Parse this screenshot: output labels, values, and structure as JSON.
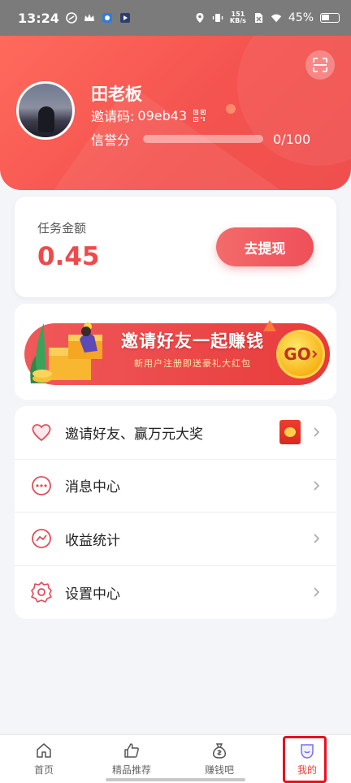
{
  "status_bar": {
    "time": "13:24",
    "network_speed_value": "151",
    "network_speed_unit": "KB/s",
    "battery": "45%"
  },
  "profile": {
    "name": "田老板",
    "invite_label": "邀请码:",
    "invite_code": "09eb43",
    "credit_label": "信誉分",
    "credit_value": "0/100",
    "credit_fraction": 0.0
  },
  "amount": {
    "label": "任务金额",
    "value": "0.45",
    "withdraw_label": "去提现"
  },
  "banner": {
    "title": "邀请好友一起赚钱",
    "subtitle": "新用户注册即送豪礼大红包",
    "go_label": "GO"
  },
  "menu": [
    {
      "label": "邀请好友、赢万元大奖",
      "icon": "heart-icon"
    },
    {
      "label": "消息中心",
      "icon": "message-icon"
    },
    {
      "label": "收益统计",
      "icon": "stats-icon"
    },
    {
      "label": "设置中心",
      "icon": "settings-icon"
    }
  ],
  "tabs": [
    {
      "label": "首页",
      "icon": "home-icon",
      "active": false
    },
    {
      "label": "精品推荐",
      "icon": "thumbs-up-icon",
      "active": false
    },
    {
      "label": "赚钱吧",
      "icon": "money-bag-icon",
      "active": false
    },
    {
      "label": "我的",
      "icon": "profile-icon",
      "active": true
    }
  ],
  "colors": {
    "accent": "#ef4f4d",
    "amount_red": "#ef4a4a",
    "active_tab": "#e8453c"
  }
}
